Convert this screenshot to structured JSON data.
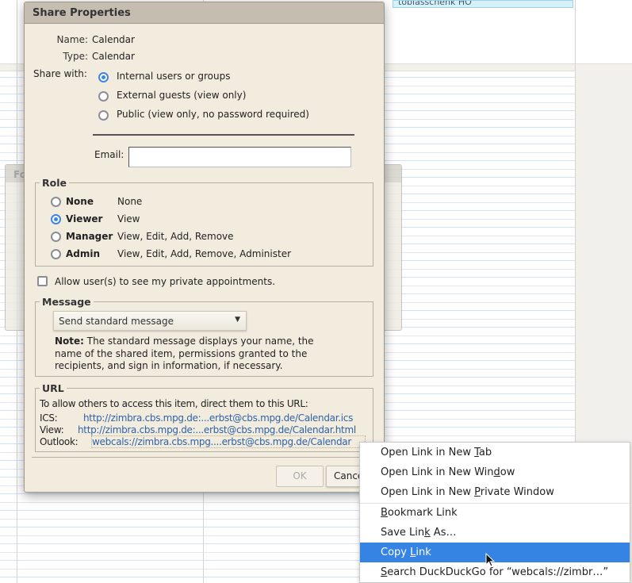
{
  "background": {
    "event_label": "tobiasschenk HO",
    "behind_dialog_title": "Fo"
  },
  "dialog": {
    "title": "Share Properties",
    "name_label": "Name:",
    "name_value": "Calendar",
    "type_label": "Type:",
    "type_value": "Calendar",
    "share_with_label": "Share with:",
    "share_options": [
      {
        "label": "Internal users or groups",
        "selected": true
      },
      {
        "label": "External guests (view only)",
        "selected": false
      },
      {
        "label": "Public (view only, no password required)",
        "selected": false
      }
    ],
    "email_label": "Email:",
    "email_value": "",
    "role": {
      "legend": "Role",
      "options": [
        {
          "name": "None",
          "desc": "None",
          "selected": false
        },
        {
          "name": "Viewer",
          "desc": "View",
          "selected": true
        },
        {
          "name": "Manager",
          "desc": "View, Edit, Add, Remove",
          "selected": false
        },
        {
          "name": "Admin",
          "desc": "View, Edit, Add, Remove, Administer",
          "selected": false
        }
      ]
    },
    "private_checkbox": {
      "label": "Allow user(s) to see my private appointments.",
      "checked": false
    },
    "message": {
      "legend": "Message",
      "select_value": "Send standard message",
      "note_bold": "Note:",
      "note_text": " The standard message displays your name, the name of the shared item, permissions granted to the recipients, and sign in information, if necessary."
    },
    "url": {
      "legend": "URL",
      "intro": "To allow others to access this item, direct them to this URL:",
      "ics_label": "ICS:",
      "ics_link": "http://zimbra.cbs.mpg.de:...erbst@cbs.mpg.de/Calendar.ics",
      "view_label": "View:",
      "view_link": "http://zimbra.cbs.mpg.de:...erbst@cbs.mpg.de/Calendar.html",
      "outlook_label": "Outlook:",
      "outlook_link": "webcals://zimbra.cbs.mpg....erbst@cbs.mpg.de/Calendar"
    },
    "ok_label": "OK",
    "cancel_label": "Cance"
  },
  "context_menu": {
    "items": [
      {
        "pre": "Open Link in New ",
        "key": "T",
        "post": "ab"
      },
      {
        "pre": "Open Link in New Win",
        "key": "d",
        "post": "ow"
      },
      {
        "pre": "Open Link in New ",
        "key": "P",
        "post": "rivate Window"
      },
      {
        "pre": "",
        "key": "B",
        "post": "ookmark Link"
      },
      {
        "pre": "Save Lin",
        "key": "k",
        "post": " As…"
      },
      {
        "pre": "Copy ",
        "key": "L",
        "post": "ink",
        "highlighted": true
      },
      {
        "pre": "",
        "key": "S",
        "post": "earch DuckDuckGo for “webcals://zimbr…”"
      }
    ]
  },
  "colors": {
    "accent": "#3584e4",
    "link": "#2f62a4",
    "dialog_bg": "#f2ecdf",
    "titlebar": "#c4bdb0"
  }
}
